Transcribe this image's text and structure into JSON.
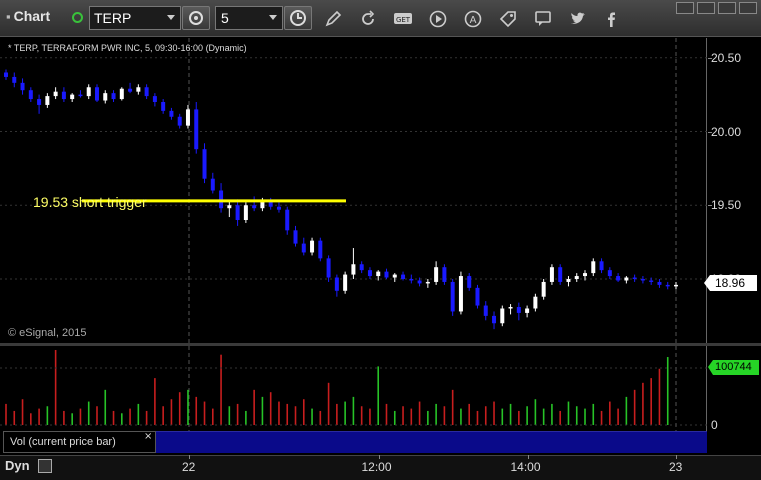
{
  "toolbar": {
    "title": "Chart",
    "symbol": "TERP",
    "interval": "5",
    "icons": [
      "target-icon",
      "clock-icon",
      "pencil-icon",
      "refresh-icon",
      "get-icon",
      "play-icon",
      "a-circle-icon",
      "tag-icon",
      "comment-icon",
      "twitter-icon",
      "facebook-icon"
    ]
  },
  "chart": {
    "title": "* TERP, TERRAFORM PWR INC, 5, 09:30-16:00 (Dynamic)",
    "annotation": "19.53 short trigger",
    "copyright": "© eSignal, 2015",
    "last_price": "18.96",
    "volume_last": "100744",
    "volume_label": "Vol (current price bar)",
    "volume_close": "×",
    "footer_mode": "Dyn",
    "colors": {
      "up": "#ffffff",
      "down": "#1a1aff",
      "trigger_line": "#ffff00",
      "vol_up": "#27c327",
      "vol_down": "#c81e1e"
    }
  },
  "chart_data": {
    "type": "candlestick",
    "y_ticks": [
      "20.50",
      "20.00",
      "19.50",
      "19.00"
    ],
    "y_hidden_tick": "19.00",
    "vol_ticks": [
      "0"
    ],
    "x_ticks": [
      "22",
      "12:00",
      "14:00",
      "23"
    ],
    "ylim": [
      18.6,
      20.6
    ],
    "trigger_level": 19.53,
    "candles": [
      [
        20.4,
        20.42,
        20.35,
        20.37
      ],
      [
        20.37,
        20.4,
        20.3,
        20.33
      ],
      [
        20.33,
        20.36,
        20.25,
        20.28
      ],
      [
        20.28,
        20.3,
        20.2,
        20.22
      ],
      [
        20.22,
        20.25,
        20.12,
        20.18
      ],
      [
        20.18,
        20.26,
        20.16,
        20.24
      ],
      [
        20.24,
        20.3,
        20.22,
        20.27
      ],
      [
        20.27,
        20.3,
        20.2,
        20.22
      ],
      [
        20.22,
        20.26,
        20.2,
        20.25
      ],
      [
        20.25,
        20.28,
        20.23,
        20.24
      ],
      [
        20.24,
        20.32,
        20.22,
        20.3
      ],
      [
        20.3,
        20.32,
        20.2,
        20.21
      ],
      [
        20.21,
        20.28,
        20.19,
        20.26
      ],
      [
        20.26,
        20.28,
        20.2,
        20.22
      ],
      [
        20.22,
        20.3,
        20.21,
        20.29
      ],
      [
        20.29,
        20.33,
        20.26,
        20.27
      ],
      [
        20.27,
        20.32,
        20.25,
        20.3
      ],
      [
        20.3,
        20.32,
        20.22,
        20.24
      ],
      [
        20.24,
        20.26,
        20.17,
        20.2
      ],
      [
        20.2,
        20.22,
        20.12,
        20.14
      ],
      [
        20.14,
        20.16,
        20.08,
        20.1
      ],
      [
        20.1,
        20.12,
        20.02,
        20.04
      ],
      [
        20.04,
        20.18,
        20.02,
        20.15
      ],
      [
        20.15,
        20.2,
        19.85,
        19.88
      ],
      [
        19.88,
        19.92,
        19.65,
        19.68
      ],
      [
        19.68,
        19.72,
        19.58,
        19.6
      ],
      [
        19.6,
        19.65,
        19.45,
        19.48
      ],
      [
        19.48,
        19.53,
        19.42,
        19.5
      ],
      [
        19.5,
        19.54,
        19.36,
        19.4
      ],
      [
        19.4,
        19.52,
        19.38,
        19.5
      ],
      [
        19.5,
        19.56,
        19.46,
        19.48
      ],
      [
        19.48,
        19.55,
        19.46,
        19.53
      ],
      [
        19.53,
        19.55,
        19.47,
        19.49
      ],
      [
        19.49,
        19.52,
        19.45,
        19.47
      ],
      [
        19.47,
        19.49,
        19.3,
        19.33
      ],
      [
        19.33,
        19.36,
        19.22,
        19.24
      ],
      [
        19.24,
        19.28,
        19.16,
        19.18
      ],
      [
        19.18,
        19.28,
        19.16,
        19.26
      ],
      [
        19.26,
        19.28,
        19.12,
        19.14
      ],
      [
        19.14,
        19.16,
        18.98,
        19.01
      ],
      [
        19.01,
        19.03,
        18.88,
        18.92
      ],
      [
        18.92,
        19.05,
        18.9,
        19.03
      ],
      [
        19.03,
        19.21,
        19.0,
        19.1
      ],
      [
        19.1,
        19.12,
        19.04,
        19.06
      ],
      [
        19.06,
        19.08,
        19.0,
        19.02
      ],
      [
        19.02,
        19.06,
        18.99,
        19.05
      ],
      [
        19.05,
        19.07,
        19.0,
        19.01
      ],
      [
        19.01,
        19.04,
        18.98,
        19.03
      ],
      [
        19.03,
        19.05,
        18.99,
        19.0
      ],
      [
        19.0,
        19.03,
        18.97,
        18.99
      ],
      [
        18.99,
        19.01,
        18.95,
        18.97
      ],
      [
        18.97,
        19.0,
        18.94,
        18.98
      ],
      [
        18.98,
        19.12,
        18.96,
        19.08
      ],
      [
        19.08,
        19.1,
        18.96,
        18.98
      ],
      [
        18.98,
        19.0,
        18.75,
        18.78
      ],
      [
        18.78,
        19.05,
        18.76,
        19.02
      ],
      [
        19.02,
        19.04,
        18.92,
        18.94
      ],
      [
        18.94,
        18.96,
        18.8,
        18.82
      ],
      [
        18.82,
        18.85,
        18.72,
        18.75
      ],
      [
        18.75,
        18.78,
        18.66,
        18.7
      ],
      [
        18.7,
        18.82,
        18.68,
        18.8
      ],
      [
        18.8,
        18.83,
        18.76,
        18.81
      ],
      [
        18.81,
        18.84,
        18.72,
        18.77
      ],
      [
        18.77,
        18.82,
        18.74,
        18.8
      ],
      [
        18.8,
        18.9,
        18.78,
        18.88
      ],
      [
        18.88,
        19.0,
        18.86,
        18.98
      ],
      [
        18.98,
        19.1,
        18.96,
        19.08
      ],
      [
        19.08,
        19.1,
        18.96,
        18.98
      ],
      [
        18.98,
        19.02,
        18.95,
        19.0
      ],
      [
        19.0,
        19.04,
        18.98,
        19.02
      ],
      [
        19.02,
        19.06,
        18.99,
        19.04
      ],
      [
        19.04,
        19.14,
        19.02,
        19.12
      ],
      [
        19.12,
        19.14,
        19.04,
        19.06
      ],
      [
        19.06,
        19.08,
        19.0,
        19.02
      ],
      [
        19.02,
        19.04,
        18.98,
        18.99
      ],
      [
        18.99,
        19.02,
        18.97,
        19.01
      ],
      [
        19.01,
        19.03,
        18.98,
        19.0
      ],
      [
        19.0,
        19.02,
        18.97,
        18.99
      ],
      [
        18.99,
        19.01,
        18.96,
        18.98
      ],
      [
        18.98,
        19.0,
        18.94,
        18.96
      ],
      [
        18.96,
        18.98,
        18.93,
        18.95
      ],
      [
        18.95,
        18.98,
        18.93,
        18.96
      ]
    ],
    "volumes": [
      18,
      12,
      22,
      10,
      14,
      16,
      64,
      12,
      10,
      14,
      20,
      16,
      30,
      12,
      10,
      14,
      18,
      12,
      40,
      16,
      22,
      28,
      30,
      24,
      20,
      14,
      60,
      16,
      18,
      12,
      30,
      24,
      28,
      20,
      18,
      16,
      22,
      14,
      12,
      36,
      18,
      20,
      24,
      16,
      14,
      50,
      18,
      12,
      16,
      14,
      20,
      12,
      18,
      16,
      30,
      14,
      18,
      12,
      16,
      20,
      14,
      18,
      12,
      16,
      22,
      14,
      18,
      12,
      20,
      16,
      14,
      18,
      12,
      20,
      14,
      24,
      30,
      36,
      40,
      48,
      58
    ],
    "volume_dir": [
      0,
      0,
      0,
      0,
      0,
      1,
      0,
      0,
      1,
      0,
      1,
      0,
      1,
      0,
      1,
      0,
      1,
      0,
      0,
      0,
      0,
      0,
      1,
      0,
      0,
      0,
      0,
      1,
      0,
      1,
      0,
      1,
      0,
      0,
      0,
      0,
      0,
      1,
      0,
      0,
      0,
      1,
      1,
      0,
      0,
      1,
      0,
      1,
      0,
      0,
      0,
      1,
      1,
      0,
      0,
      1,
      0,
      0,
      0,
      0,
      1,
      1,
      0,
      1,
      1,
      1,
      1,
      0,
      1,
      1,
      1,
      1,
      0,
      0,
      0,
      1,
      0,
      0,
      0,
      0,
      1
    ],
    "volume_max": 100744
  }
}
